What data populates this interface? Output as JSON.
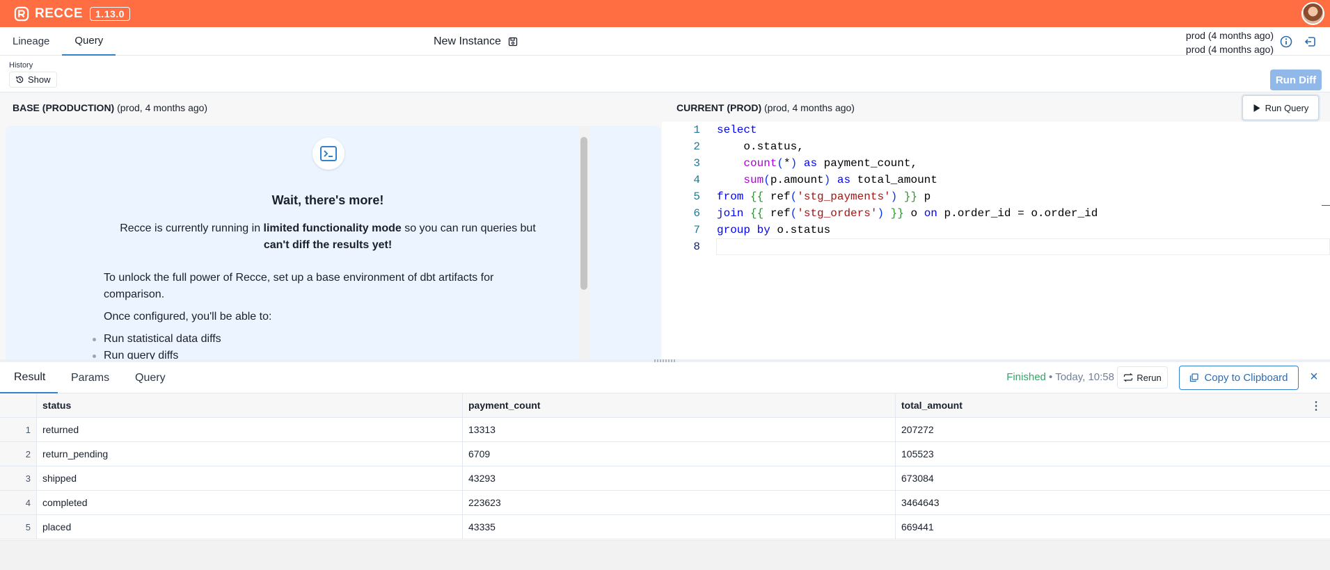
{
  "app": {
    "name": "RECCE",
    "version": "1.13.0"
  },
  "nav": {
    "tabs": [
      {
        "label": "Lineage"
      },
      {
        "label": "Query"
      }
    ],
    "instance_name": "New Instance",
    "env_lines": [
      "prod (4 months ago)",
      "prod (4 months ago)"
    ]
  },
  "history": {
    "label": "History",
    "show_label": "Show",
    "run_diff_label": "Run Diff"
  },
  "base": {
    "title": "BASE (PRODUCTION)",
    "subtitle": "(prod, 4 months ago)"
  },
  "current": {
    "title": "CURRENT (PROD)",
    "subtitle": "(prod, 4 months ago)",
    "run_query_label": "Run Query"
  },
  "notice": {
    "heading": "Wait, there's more!",
    "lead_a": "Recce is currently running in ",
    "lead_b": "limited functionality mode",
    "lead_c": " so you can run queries but ",
    "lead_d": "can't diff the results yet!",
    "para1": "To unlock the full power of Recce, set up a base environment of dbt artifacts for comparison.",
    "para2": "Once configured, you'll be able to:",
    "bullets": [
      "Run statistical data diffs",
      "Run query diffs"
    ]
  },
  "editor": {
    "line_numbers": [
      "1",
      "2",
      "3",
      "4",
      "5",
      "6",
      "7",
      "8"
    ],
    "lines": [
      "select",
      "    o.status,",
      "    count(*) as payment_count,",
      "    sum(p.amount) as total_amount",
      "from {{ ref('stg_payments') }} p",
      "join {{ ref('stg_orders') }} o on p.order_id = o.order_id",
      "group by o.status",
      ""
    ]
  },
  "results": {
    "tabs": [
      {
        "label": "Result"
      },
      {
        "label": "Params"
      },
      {
        "label": "Query"
      }
    ],
    "status_ok": "Finished",
    "status_time": " • Today, 10:58",
    "rerun_label": "Rerun",
    "copy_label": "Copy to Clipboard",
    "columns": [
      "status",
      "payment_count",
      "total_amount"
    ],
    "rows": [
      {
        "n": "1",
        "status": "returned",
        "payment_count": "13313",
        "total_amount": "207272"
      },
      {
        "n": "2",
        "status": "return_pending",
        "payment_count": "6709",
        "total_amount": "105523"
      },
      {
        "n": "3",
        "status": "shipped",
        "payment_count": "43293",
        "total_amount": "673084"
      },
      {
        "n": "4",
        "status": "completed",
        "payment_count": "223623",
        "total_amount": "3464643"
      },
      {
        "n": "5",
        "status": "placed",
        "payment_count": "43335",
        "total_amount": "669441"
      }
    ]
  },
  "colors": {
    "brand": "#ff6e42",
    "accent": "#3182ce",
    "success": "#38a169"
  }
}
